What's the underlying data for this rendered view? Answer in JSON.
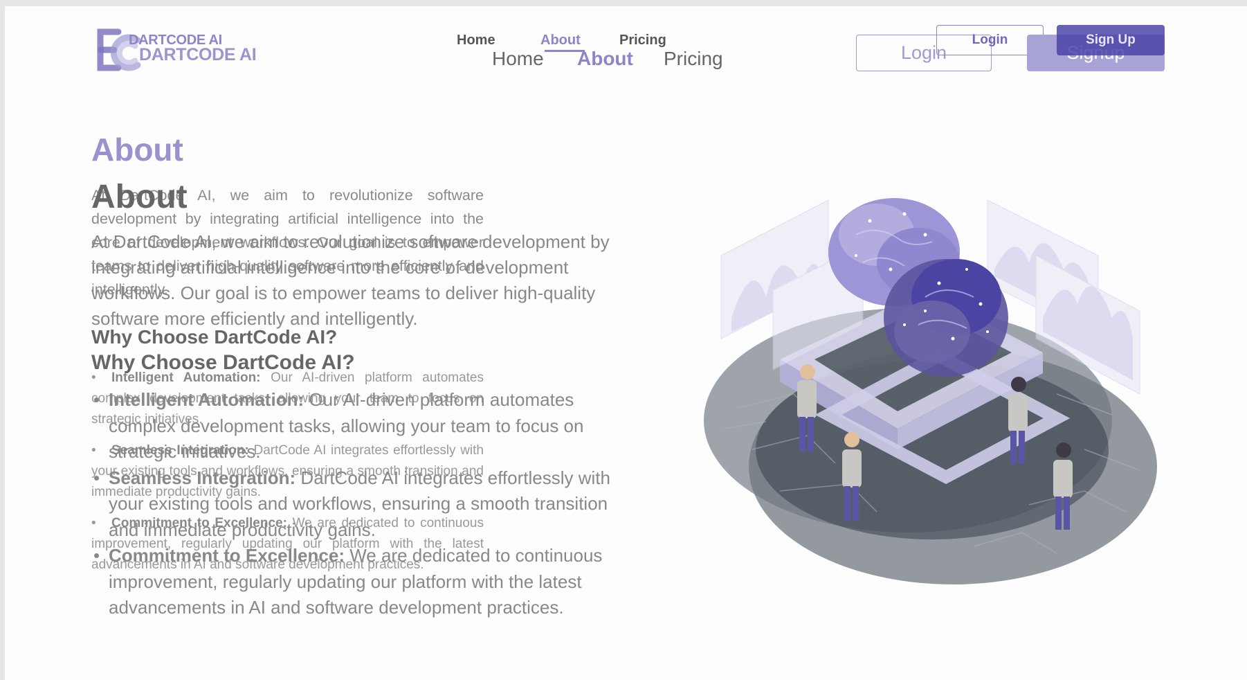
{
  "brand": {
    "name_small": "DARTCODE AI",
    "name_big": "DARTCODE AI"
  },
  "nav_small": {
    "home": "Home",
    "about": "About",
    "pricing": "Pricing"
  },
  "nav_big": {
    "home": "Home",
    "about": "About",
    "pricing": "Pricing"
  },
  "auth_small": {
    "login": "Login",
    "signup": "Sign Up"
  },
  "auth_big": {
    "login": "Login",
    "signup": "Signup"
  },
  "about_small": {
    "title": "About",
    "body": "At DartCode AI, we aim to revolutionize software development by integrating artificial intelligence into the core of development workflows. Our goal is to empower teams to deliver high-quality software more efficiently and intelligently."
  },
  "about_big": {
    "title": "About",
    "body": "At DartCode AI, we aim to revolutionize software development by integrating artificial intelligence into the core of development workflows. Our goal is to empower teams to deliver high-quality software more efficiently and intelligently."
  },
  "why_small": {
    "title": "Why Choose DartCode AI?",
    "items": [
      {
        "label": "Intelligent Automation:",
        "text": " Our AI-driven platform automates complex development tasks, allowing your team to focus on strategic initiatives."
      },
      {
        "label": "Seamless Integration:",
        "text": " DartCode AI integrates effortlessly with your existing tools and workflows, ensuring a smooth transition and immediate productivity gains."
      },
      {
        "label": "Commitment to Excellence:",
        "text": " We are dedicated to continuous improvement, regularly updating our platform with the latest advancements in AI and software development practices."
      }
    ]
  },
  "why_big": {
    "title": "Why Choose DartCode AI?",
    "items": [
      {
        "label": "Intelligent Automation:",
        "text": " Our AI-driven platform automates complex development tasks, allowing your team to focus on strategic initiatives."
      },
      {
        "label": "Seamless Integration:",
        "text": " DartCode AI integrates effortlessly with your existing tools and workflows, ensuring a smooth transition and immediate productivity gains."
      },
      {
        "label": "Commitment to Excellence:",
        "text": " We are dedicated to continuous improvement, regularly updating our platform with the latest advancements in AI and software development practices."
      }
    ]
  },
  "colors": {
    "accent": "#8c86c8",
    "accent_dark": "#4b45a8",
    "text": "#555555"
  }
}
